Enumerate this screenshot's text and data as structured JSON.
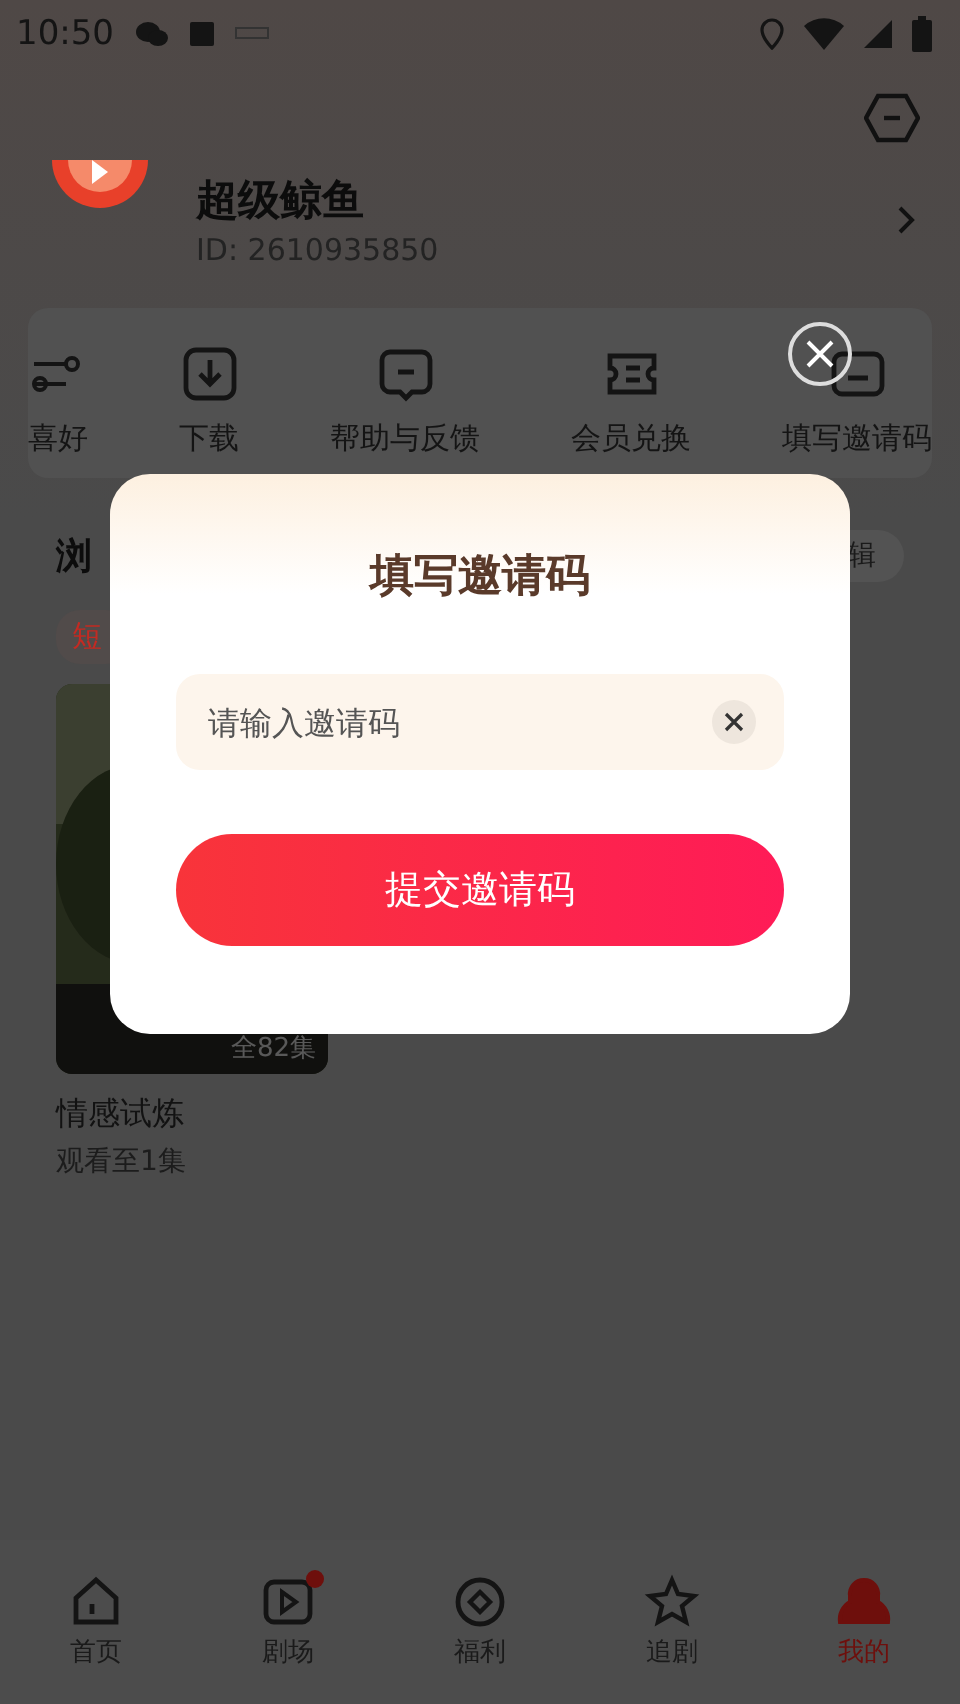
{
  "status_bar": {
    "time": "10:50"
  },
  "profile": {
    "name": "超级鲸鱼",
    "id": "ID: 2610935850"
  },
  "shortcuts": [
    {
      "kind": "sliders",
      "label": "喜好"
    },
    {
      "kind": "download",
      "label": "下载"
    },
    {
      "kind": "feedback",
      "label": "帮助与反馈"
    },
    {
      "kind": "ticket",
      "label": "会员兑换"
    },
    {
      "kind": "invite",
      "label": "填写邀请码"
    }
  ],
  "history": {
    "title": "浏",
    "edit": "辑",
    "tag": "短",
    "items": [
      {
        "kind": "picture",
        "badge": "全82集",
        "title": "情感试炼",
        "progress": "观看至1集"
      }
    ]
  },
  "tab_bar": [
    {
      "kind": "home",
      "label": "首页",
      "selected": false,
      "badge": false
    },
    {
      "kind": "play",
      "label": "剧场",
      "selected": false,
      "badge": true
    },
    {
      "kind": "coin",
      "label": "福利",
      "selected": false,
      "badge": false
    },
    {
      "kind": "star",
      "label": "追剧",
      "selected": false,
      "badge": false
    },
    {
      "kind": "person",
      "label": "我的",
      "selected": true,
      "badge": false
    }
  ],
  "dialog": {
    "title": "填写邀请码",
    "placeholder": "请输入邀请码",
    "submit": "提交邀请码"
  }
}
